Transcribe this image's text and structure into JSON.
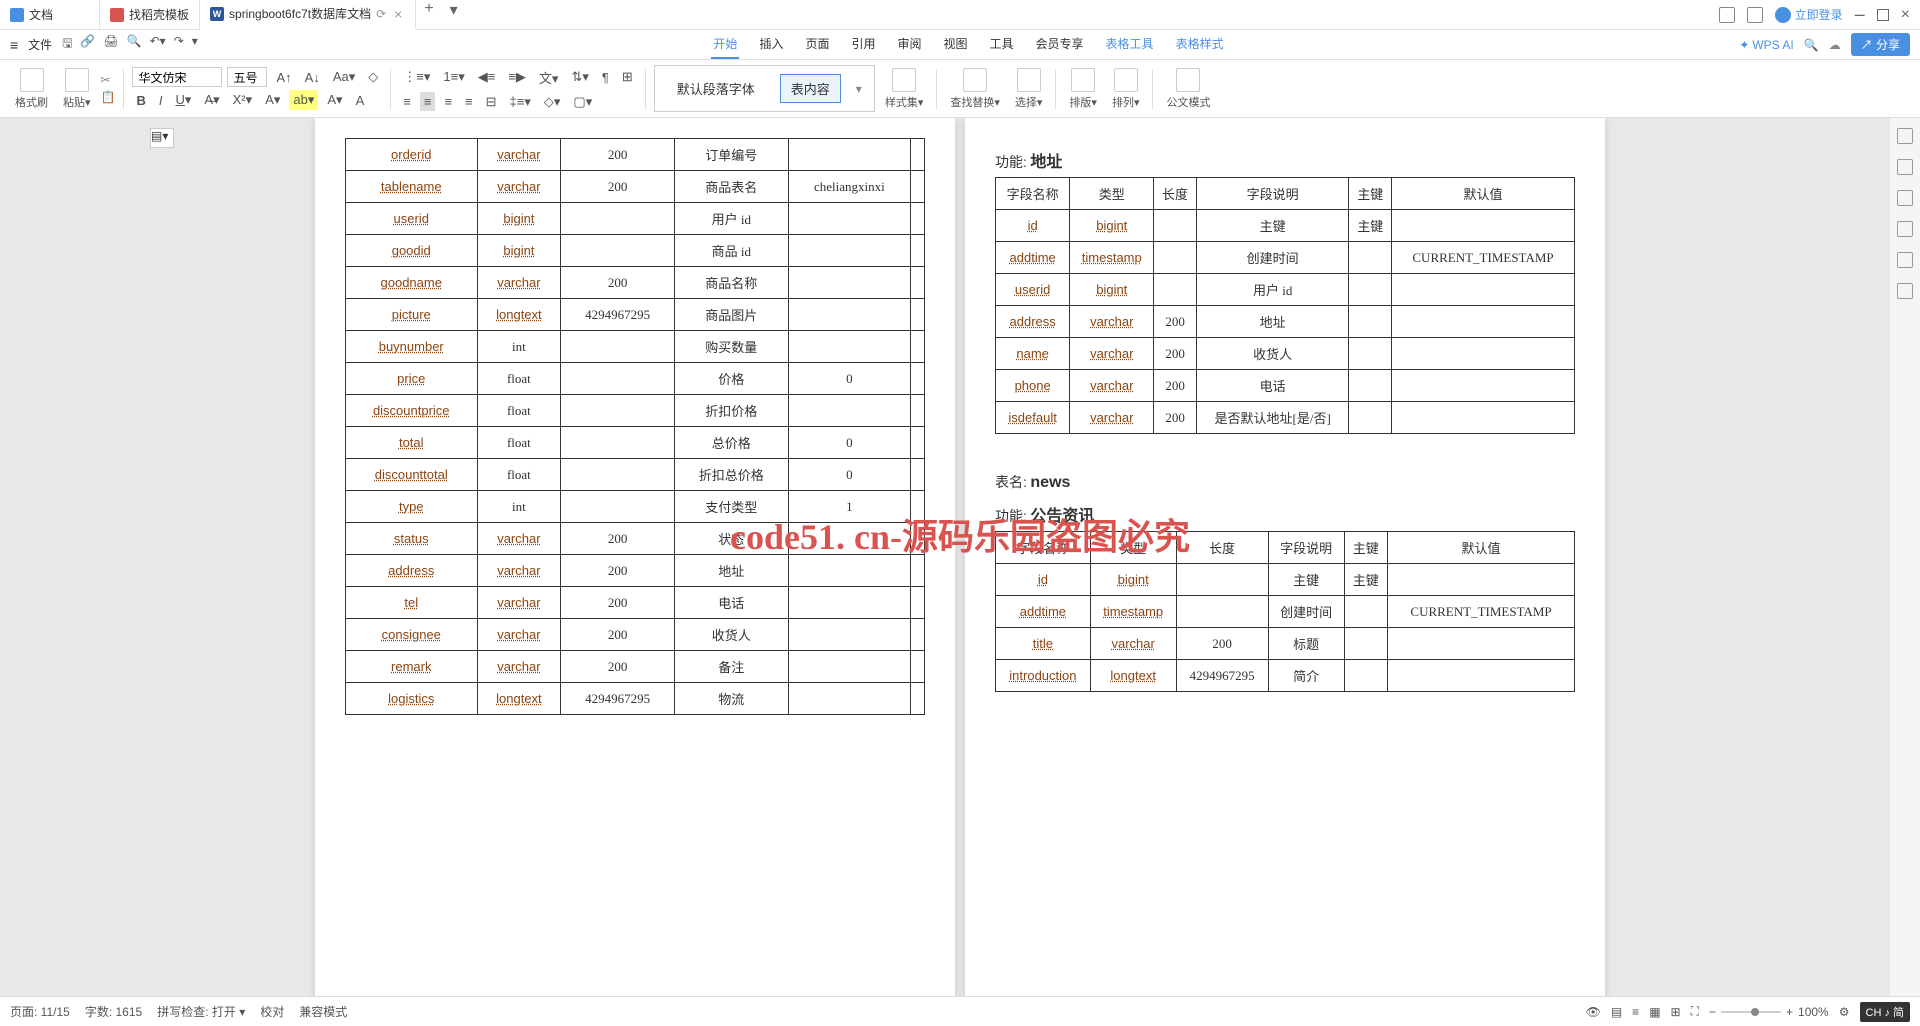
{
  "tabs": [
    {
      "icon": "doc",
      "label": "文档"
    },
    {
      "icon": "red",
      "label": "找稻壳模板"
    },
    {
      "icon": "word",
      "label": "springboot6fc7t数据库文档"
    }
  ],
  "titlebar": {
    "login": "立即登录"
  },
  "menubar": {
    "file": "文件",
    "items": [
      "开始",
      "插入",
      "页面",
      "引用",
      "审阅",
      "视图",
      "工具",
      "会员专享",
      "表格工具",
      "表格样式"
    ],
    "wpsai": "WPS AI",
    "share": "分享"
  },
  "ribbon": {
    "format_painter": "格式刷",
    "paste": "粘贴",
    "font": "华文仿宋",
    "size": "五号",
    "style_default": "默认段落字体",
    "style_content": "表内容",
    "styles": "样式集",
    "find": "查找替换",
    "select": "选择",
    "layout": "排版",
    "arrange": "排列",
    "official": "公文模式"
  },
  "left_table": {
    "rows": [
      {
        "c": [
          "orderid",
          "varchar",
          "200",
          "订单编号",
          ""
        ]
      },
      {
        "c": [
          "tablename",
          "varchar",
          "200",
          "商品表名",
          "cheliangxinxi"
        ]
      },
      {
        "c": [
          "userid",
          "bigint",
          "",
          "用户 id",
          ""
        ]
      },
      {
        "c": [
          "goodid",
          "bigint",
          "",
          "商品 id",
          ""
        ]
      },
      {
        "c": [
          "goodname",
          "varchar",
          "200",
          "商品名称",
          ""
        ]
      },
      {
        "c": [
          "picture",
          "longtext",
          "4294967295",
          "商品图片",
          ""
        ]
      },
      {
        "c": [
          "buynumber",
          "int",
          "",
          "购买数量",
          ""
        ]
      },
      {
        "c": [
          "price",
          "float",
          "",
          "价格",
          "0"
        ]
      },
      {
        "c": [
          "discountprice",
          "float",
          "",
          "折扣价格",
          ""
        ]
      },
      {
        "c": [
          "total",
          "float",
          "",
          "总价格",
          "0"
        ]
      },
      {
        "c": [
          "discounttotal",
          "float",
          "",
          "折扣总价格",
          "0"
        ]
      },
      {
        "c": [
          "type",
          "int",
          "",
          "支付类型",
          "1"
        ]
      },
      {
        "c": [
          "status",
          "varchar",
          "200",
          "状态",
          ""
        ]
      },
      {
        "c": [
          "address",
          "varchar",
          "200",
          "地址",
          ""
        ]
      },
      {
        "c": [
          "tel",
          "varchar",
          "200",
          "电话",
          ""
        ]
      },
      {
        "c": [
          "consignee",
          "varchar",
          "200",
          "收货人",
          ""
        ]
      },
      {
        "c": [
          "remark",
          "varchar",
          "200",
          "备注",
          ""
        ]
      },
      {
        "c": [
          "logistics",
          "longtext",
          "4294967295",
          "物流",
          ""
        ]
      }
    ]
  },
  "right_page": {
    "section1": {
      "func_label": "功能:",
      "func": "地址",
      "headers": [
        "字段名称",
        "类型",
        "长度",
        "字段说明",
        "主键",
        "默认值"
      ],
      "rows": [
        {
          "c": [
            "id",
            "bigint",
            "",
            "主键",
            "主键",
            ""
          ]
        },
        {
          "c": [
            "addtime",
            "timestamp",
            "",
            "创建时间",
            "",
            "CURRENT_TIMESTAMP"
          ]
        },
        {
          "c": [
            "userid",
            "bigint",
            "",
            "用户 id",
            "",
            ""
          ]
        },
        {
          "c": [
            "address",
            "varchar",
            "200",
            "地址",
            "",
            ""
          ]
        },
        {
          "c": [
            "name",
            "varchar",
            "200",
            "收货人",
            "",
            ""
          ]
        },
        {
          "c": [
            "phone",
            "varchar",
            "200",
            "电话",
            "",
            ""
          ]
        },
        {
          "c": [
            "isdefault",
            "varchar",
            "200",
            "是否默认地址[是/否]",
            "",
            ""
          ]
        }
      ]
    },
    "section2": {
      "name_label": "表名:",
      "name": "news",
      "func_label": "功能:",
      "func": "公告资讯",
      "headers": [
        "字段名称",
        "类型",
        "长度",
        "字段说明",
        "主键",
        "默认值"
      ],
      "rows": [
        {
          "c": [
            "id",
            "bigint",
            "",
            "主键",
            "主键",
            ""
          ]
        },
        {
          "c": [
            "addtime",
            "timestamp",
            "",
            "创建时间",
            "",
            "CURRENT_TIMESTAMP"
          ]
        },
        {
          "c": [
            "title",
            "varchar",
            "200",
            "标题",
            "",
            ""
          ]
        },
        {
          "c": [
            "introduction",
            "longtext",
            "4294967295",
            "简介",
            "",
            ""
          ]
        }
      ]
    }
  },
  "watermark": "code51. cn-源码乐园盗图必究",
  "statusbar": {
    "page": "页面: 11/15",
    "words": "字数: 1615",
    "spell": "拼写检查: 打开",
    "proof": "校对",
    "compat": "兼容模式",
    "zoom": "100%",
    "ime": "CH ♪ 简"
  }
}
